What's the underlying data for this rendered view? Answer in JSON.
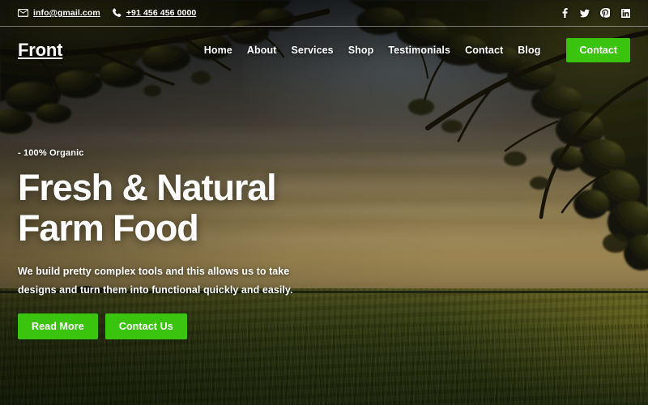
{
  "topbar": {
    "email": "info@gmail.com",
    "email_icon": "envelope-icon",
    "phone": "+91 456 456 0000",
    "phone_icon": "phone-icon",
    "socials": [
      {
        "name": "facebook-icon",
        "label": "f"
      },
      {
        "name": "twitter-icon",
        "label": "t"
      },
      {
        "name": "pinterest-icon",
        "label": "p"
      },
      {
        "name": "linkedin-icon",
        "label": "in"
      }
    ]
  },
  "header": {
    "logo": "Front",
    "nav": [
      {
        "label": "Home"
      },
      {
        "label": "About"
      },
      {
        "label": "Services"
      },
      {
        "label": "Shop"
      },
      {
        "label": "Testimonials"
      },
      {
        "label": "Contact"
      },
      {
        "label": "Blog"
      }
    ],
    "cta_label": "Contact"
  },
  "hero": {
    "eyebrow": "- 100% Organic",
    "title_line1": "Fresh & Natural",
    "title_line2": "Farm Food",
    "paragraph": "We build pretty complex tools and this allows us to take designs and turn them into functional quickly and easily.",
    "primary_button": "Read More",
    "secondary_button": "Contact Us"
  },
  "colors": {
    "accent_green": "#3ac40e",
    "text_white": "#ffffff",
    "sky_top": "#2e3338",
    "sky_horizon": "#ab9259",
    "field_green": "#3c4714"
  }
}
